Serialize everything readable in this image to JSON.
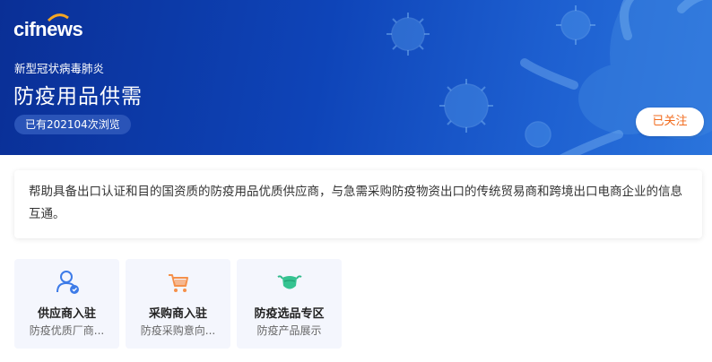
{
  "header": {
    "logo_text": "cifnews",
    "category": "新型冠状病毒肺炎",
    "title": "防疫用品供需",
    "views": "已有202104次浏览",
    "follow_label": "已关注"
  },
  "description": "帮助具备出口认证和目的国资质的防疫用品优质供应商，与急需采购防疫物资出口的传统贸易商和跨境出口电商企业的信息互通。",
  "tiles": [
    {
      "name": "供应商入驻",
      "desc": "防疫优质厂商...",
      "icon": "supplier-icon"
    },
    {
      "name": "采购商入驻",
      "desc": "防疫采购意向...",
      "icon": "cart-icon"
    },
    {
      "name": "防疫选品专区",
      "desc": "防疫产品展示",
      "icon": "mask-icon"
    }
  ],
  "colors": {
    "banner": "#0e44b8",
    "accent": "#f26b1d",
    "tile_bg": "#f4f6fd"
  }
}
